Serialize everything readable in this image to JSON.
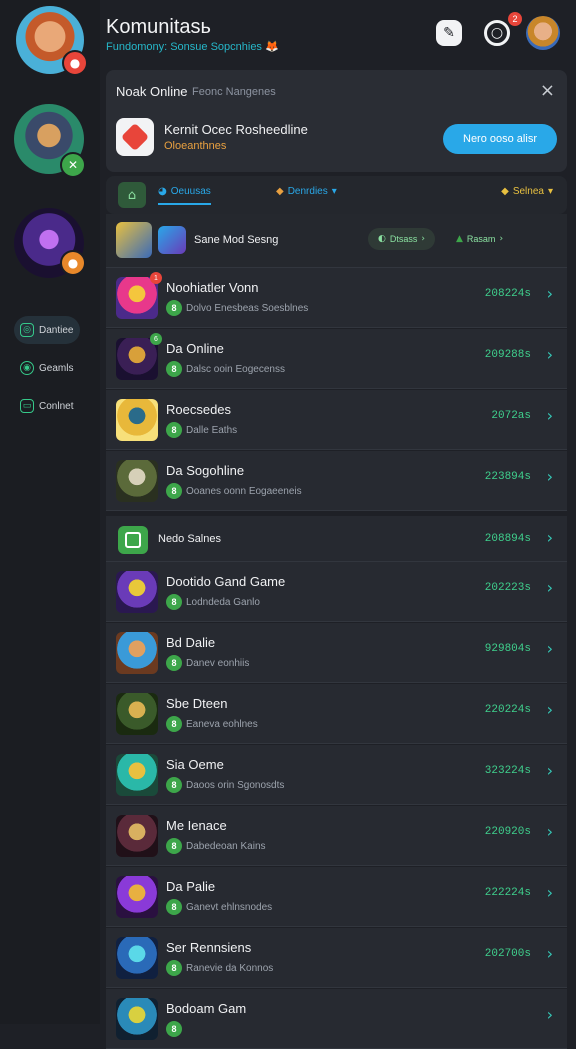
{
  "header": {
    "title": "Komunitasь",
    "subtitle": "Fundomony: Sonsue Sopcnhies",
    "subtitle_emoji": "🦊",
    "notif_count": "2"
  },
  "sidebar": {
    "nav": [
      {
        "label": "Dantiee",
        "icon": "controller-icon"
      },
      {
        "label": "Geamls",
        "icon": "globe-icon"
      },
      {
        "label": "Conlnet",
        "icon": "monitor-icon"
      }
    ]
  },
  "online_panel": {
    "title": "Nоаk Online",
    "subtitle": "Feonc Nangenes",
    "close": "×",
    "item_title": "Kernit Ocec Rosheedline",
    "item_sub": "Oloeanthnes",
    "cta_label": "Nero ooso alisr"
  },
  "filters": {
    "tab1": "Oeuusas",
    "tab2": "Denrdies",
    "tab3": "Selnea"
  },
  "section_header": {
    "title": "Sane Mod Sesng",
    "pill1": "Dtsass",
    "pill2": "Rasam"
  },
  "rows": [
    {
      "title": "Noohiatler Vonn",
      "sub": "Dolvo Enesbeas Soesblnes",
      "count": "208224s",
      "badge": "1",
      "thumb_colors": [
        "#e8388b",
        "#f4c63d",
        "#4b2a8a"
      ]
    },
    {
      "title": "Da Online",
      "sub": "Dalsc ooin Eogecenss",
      "count": "209288s",
      "badge": "6",
      "thumb_colors": [
        "#3a1f55",
        "#d8a03a",
        "#1a1030"
      ]
    },
    {
      "title": "Roecsedes",
      "sub": "Dalle Eaths",
      "count": "2072аs",
      "badge": "",
      "thumb_colors": [
        "#e8b83a",
        "#2a6b8a",
        "#f7e07a"
      ]
    },
    {
      "title": "Da Sogohline",
      "sub": "Ooanes oonn Eogaeeneis",
      "count": "223894s",
      "badge": "",
      "thumb_colors": [
        "#5b6a3a",
        "#d6d0b8",
        "#2a3020"
      ]
    }
  ],
  "section2": {
    "title": "Nedo Salnes",
    "count": "208894s"
  },
  "rows2": [
    {
      "title": "Dootido Gand Game",
      "sub": "Lodndeda Ganlo",
      "count": "202223s",
      "thumb_colors": [
        "#6a3bb8",
        "#e8c83a",
        "#2a1850"
      ]
    },
    {
      "title": "Bd Dalie",
      "sub": "Danev eonhiis",
      "count": "929804s",
      "thumb_colors": [
        "#3a9ad8",
        "#e0a060",
        "#6b3a20"
      ]
    },
    {
      "title": "Sbe Dteen",
      "sub": "Eaneva eohlnes",
      "count": "220224s",
      "thumb_colors": [
        "#3a5a2a",
        "#d8b050",
        "#1a2a10"
      ]
    },
    {
      "title": "Sia Oeme",
      "sub": "Daoos orin Sgonosdts",
      "count": "323224s",
      "thumb_colors": [
        "#2ab8a8",
        "#e8c040",
        "#1a4a3a"
      ]
    },
    {
      "title": "Me Ienace",
      "sub": "Dabedeoan Kains",
      "count": "220920s",
      "thumb_colors": [
        "#5a2a3a",
        "#d8b060",
        "#201018"
      ]
    },
    {
      "title": "Da Palie",
      "sub": "Ganevt ehlnsnodes",
      "count": "222224s",
      "thumb_colors": [
        "#8a3ad8",
        "#e8b040",
        "#2a1040"
      ]
    },
    {
      "title": "Ser Rennsiens",
      "sub": "Ranevie da Konnos",
      "count": "202700s",
      "thumb_colors": [
        "#2a6ab8",
        "#5ad8e8",
        "#102040"
      ]
    },
    {
      "title": "Bodoam Gam",
      "sub": "",
      "count": "",
      "thumb_colors": [
        "#2a8ab8",
        "#d8d040",
        "#102030"
      ]
    }
  ]
}
